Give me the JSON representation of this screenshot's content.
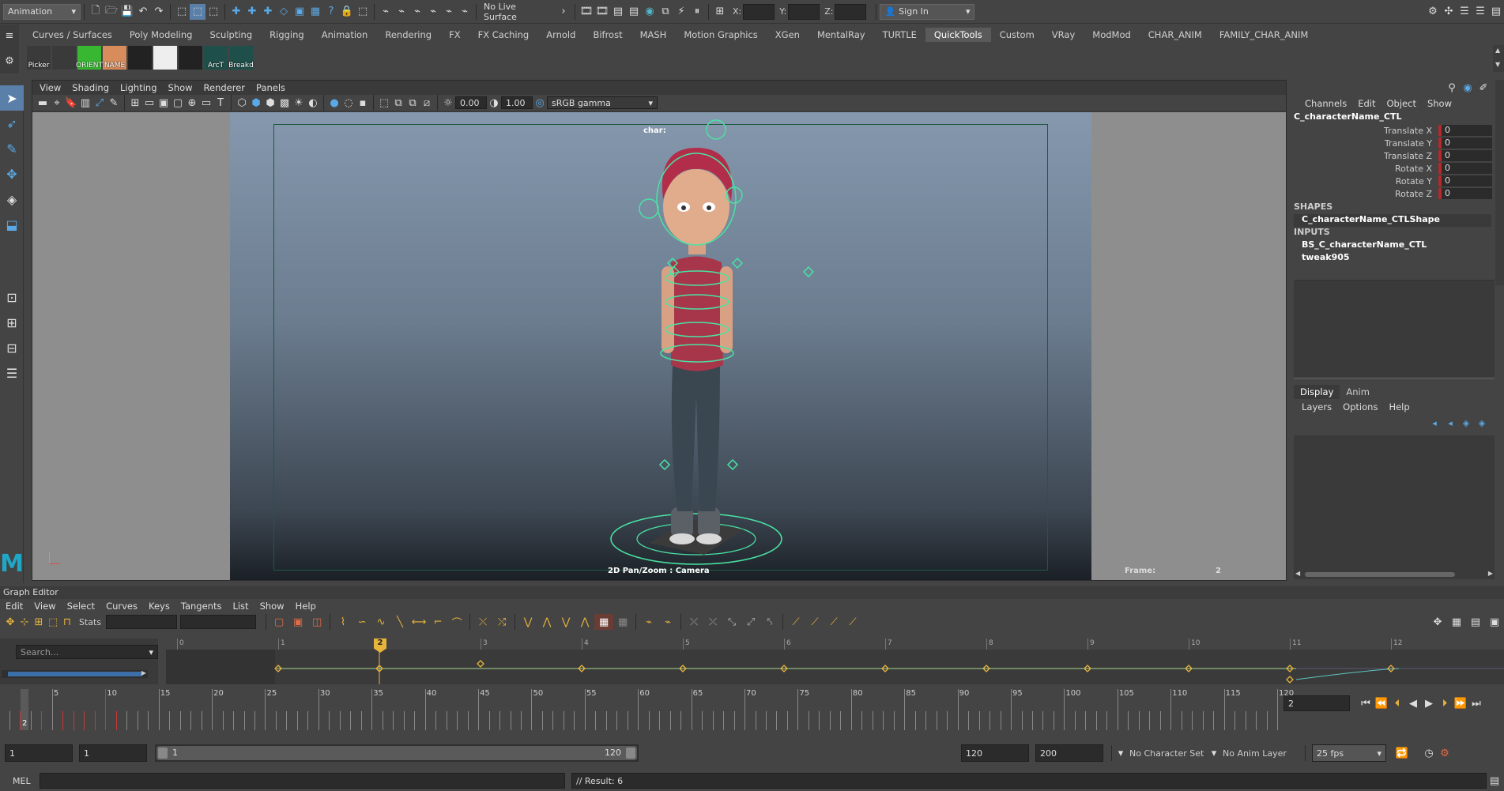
{
  "status_line": {
    "menu_set": "Animation",
    "live_surface": "No Live Surface",
    "x_label": "X:",
    "y_label": "Y:",
    "z_label": "Z:",
    "sign_in": "Sign In"
  },
  "shelf_tabs": [
    "Curves / Surfaces",
    "Poly Modeling",
    "Sculpting",
    "Rigging",
    "Animation",
    "Rendering",
    "FX",
    "FX Caching",
    "Arnold",
    "Bifrost",
    "MASH",
    "Motion Graphics",
    "XGen",
    "MentalRay",
    "TURTLE",
    "QuickTools",
    "Custom",
    "VRay",
    "ModMod",
    "CHAR_ANIM",
    "FAMILY_CHAR_ANIM"
  ],
  "active_shelf_tab": "QuickTools",
  "shelf_buttons": [
    {
      "label": "Picker",
      "color": "#3a3a3a"
    },
    {
      "label": "",
      "color": "#3a3a3a"
    },
    {
      "label": "ORIENT",
      "color": "#38b832"
    },
    {
      "label": "NAME",
      "color": "#d88c5c"
    },
    {
      "label": "",
      "color": "#222"
    },
    {
      "label": "",
      "color": "#eee"
    },
    {
      "label": "",
      "color": "#222"
    },
    {
      "label": "ArcT",
      "color": "#1f4f4a"
    },
    {
      "label": "Breakd",
      "color": "#1f4f4a"
    }
  ],
  "viewport": {
    "menu": [
      "View",
      "Shading",
      "Lighting",
      "Show",
      "Renderer",
      "Panels"
    ],
    "field_value_1": "0.00",
    "field_value_2": "1.00",
    "color_space": "sRGB gamma",
    "hud_char": "char:",
    "hud_camera": "2D Pan/Zoom : Camera",
    "hud_frame_label": "Frame:",
    "hud_frame_value": "2"
  },
  "channel_box": {
    "menu": [
      "Channels",
      "Edit",
      "Object",
      "Show"
    ],
    "object_name": "C_characterName_CTL",
    "channels": [
      {
        "name": "Translate X",
        "value": "0"
      },
      {
        "name": "Translate Y",
        "value": "0"
      },
      {
        "name": "Translate Z",
        "value": "0"
      },
      {
        "name": "Rotate X",
        "value": "0"
      },
      {
        "name": "Rotate Y",
        "value": "0"
      },
      {
        "name": "Rotate Z",
        "value": "0"
      }
    ],
    "shapes_header": "SHAPES",
    "shape_name": "C_characterName_CTLShape",
    "inputs_header": "INPUTS",
    "inputs": [
      "BS_C_characterName_CTL",
      "tweak905"
    ]
  },
  "layer_editor": {
    "tabs": [
      "Display",
      "Anim"
    ],
    "menu": [
      "Layers",
      "Options",
      "Help"
    ]
  },
  "graph_editor": {
    "title": "Graph Editor",
    "menu": [
      "Edit",
      "View",
      "Select",
      "Curves",
      "Keys",
      "Tangents",
      "List",
      "Show",
      "Help"
    ],
    "stats_label": "Stats",
    "search_placeholder": "Search...",
    "ruler_labels": [
      "0",
      "1",
      "2",
      "3",
      "4",
      "5",
      "6",
      "7",
      "8",
      "9",
      "10",
      "11",
      "12"
    ],
    "current_frame_marker": "2"
  },
  "time_slider": {
    "labels": [
      "5",
      "10",
      "15",
      "20",
      "25",
      "30",
      "35",
      "40",
      "45",
      "50",
      "55",
      "60",
      "65",
      "70",
      "75",
      "80",
      "85",
      "90",
      "95",
      "100",
      "105",
      "110",
      "115",
      "120"
    ],
    "current_frame": "2",
    "current_frame_field": "2"
  },
  "range_slider": {
    "start_field": "1",
    "start_field_2": "1",
    "range_start": "1",
    "range_end": "120",
    "end_field": "120",
    "end_field_2": "200",
    "character_set": "No Character Set",
    "anim_layer": "No Anim Layer",
    "fps": "25 fps"
  },
  "command_line": {
    "language": "MEL",
    "result": "// Result: 6"
  }
}
